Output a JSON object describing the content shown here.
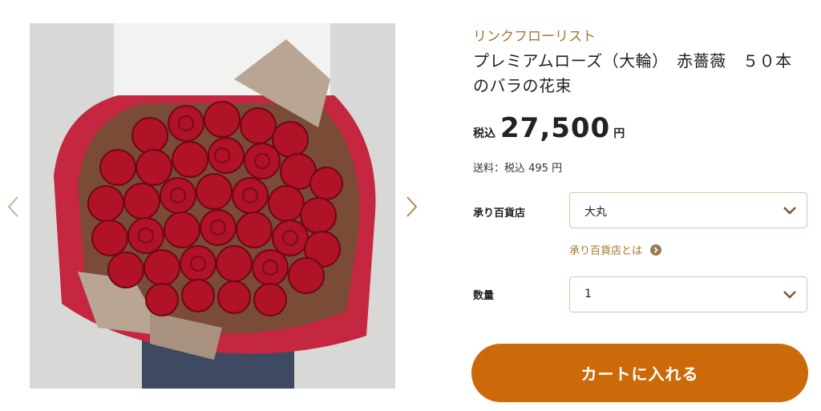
{
  "product": {
    "brand": "リンクフローリスト",
    "title": "プレミアムローズ（大輪）　赤薔薇　５０本のバラの花束",
    "price_tax_label": "税込",
    "price_amount": "27,500",
    "price_currency": "円",
    "shipping": "送料：税込 495 円"
  },
  "options": {
    "store_label": "承り百貨店",
    "store_value": "大丸",
    "about_store_link": "承り百貨店とは",
    "quantity_label": "数量",
    "quantity_value": "1"
  },
  "actions": {
    "add_to_cart": "カートに入れる"
  },
  "colors": {
    "brand": "#a8742b",
    "cart_button": "#cc6a0a",
    "select_border": "#d9c7a8"
  },
  "icons": [
    "chevron-left-icon",
    "chevron-right-icon",
    "chevron-down-icon",
    "chevron-circle-right-icon"
  ]
}
